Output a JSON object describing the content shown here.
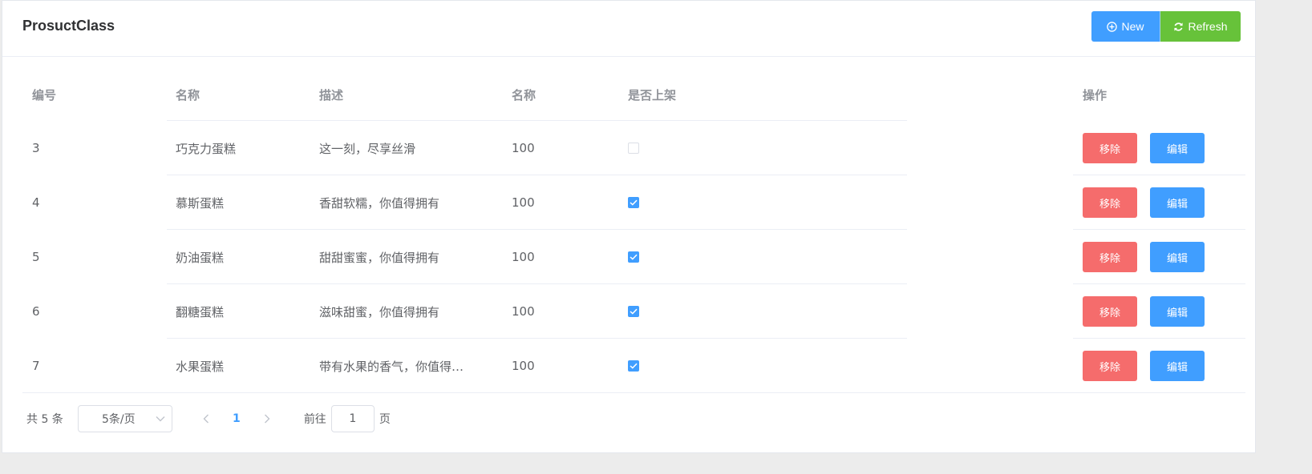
{
  "header": {
    "title": "ProsuctClass",
    "new_label": "New",
    "refresh_label": "Refresh"
  },
  "table": {
    "columns": [
      "编号",
      "名称",
      "描述",
      "名称",
      "是否上架",
      "操作"
    ],
    "rows": [
      {
        "id": "3",
        "name": "巧克力蛋糕",
        "desc": "这一刻，尽享丝滑",
        "price": "100",
        "on_shelf": false
      },
      {
        "id": "4",
        "name": "慕斯蛋糕",
        "desc": "香甜软糯，你值得拥有",
        "price": "100",
        "on_shelf": true
      },
      {
        "id": "5",
        "name": "奶油蛋糕",
        "desc": "甜甜蜜蜜，你值得拥有",
        "price": "100",
        "on_shelf": true
      },
      {
        "id": "6",
        "name": "翻糖蛋糕",
        "desc": "滋味甜蜜，你值得拥有",
        "price": "100",
        "on_shelf": true
      },
      {
        "id": "7",
        "name": "水果蛋糕",
        "desc": "带有水果的香气，你值得…",
        "price": "100",
        "on_shelf": true
      }
    ],
    "remove_label": "移除",
    "edit_label": "编辑"
  },
  "pager": {
    "total": "共 5 条",
    "page_size": "5条/页",
    "current_page": "1",
    "goto_prefix": "前往",
    "goto_value": "1",
    "goto_suffix": "页"
  },
  "colors": {
    "primary": "#409eff",
    "success": "#67c23a",
    "danger": "#f56c6c"
  },
  "icons": {
    "new": "circle-plus-icon",
    "refresh": "refresh-icon",
    "check": "check-icon",
    "chevron_down": "chevron-down-icon",
    "prev": "chevron-left-icon",
    "next": "chevron-right-icon"
  }
}
